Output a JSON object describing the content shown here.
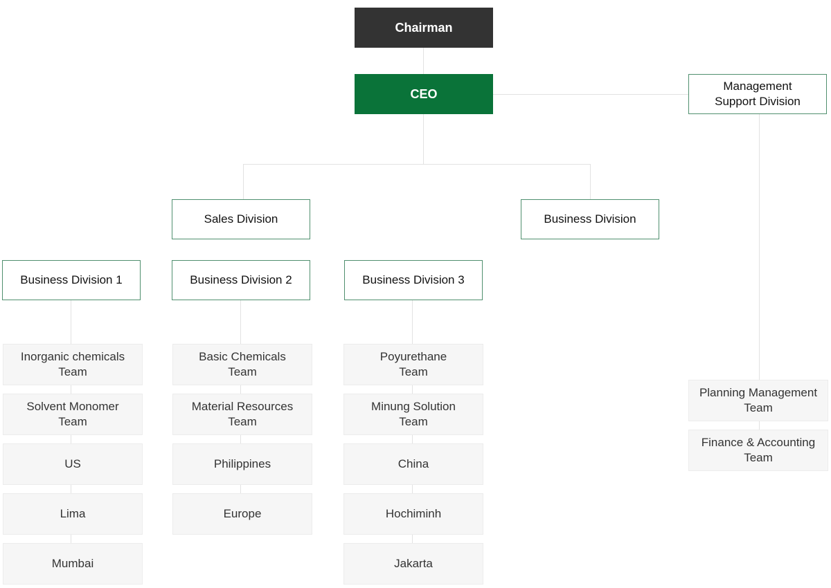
{
  "chairman": "Chairman",
  "ceo": "CEO",
  "management_support": "Management\nSupport Division",
  "sales_division": "Sales Division",
  "business_division": "Business Division",
  "divisions": [
    {
      "name": "Business Division 1",
      "teams": [
        "Inorganic chemicals\nTeam",
        "Solvent Monomer\nTeam",
        "US",
        "Lima",
        "Mumbai"
      ]
    },
    {
      "name": "Business Division 2",
      "teams": [
        "Basic Chemicals\nTeam",
        "Material Resources\nTeam",
        "Philippines",
        "Europe"
      ]
    },
    {
      "name": "Business Division 3",
      "teams": [
        "Poyurethane\nTeam",
        "Minung Solution\nTeam",
        "China",
        "Hochiminh",
        "Jakarta"
      ]
    }
  ],
  "support_teams": [
    "Planning Management\nTeam",
    "Finance & Accounting\nTeam"
  ],
  "colors": {
    "chairman_bg": "#333333",
    "ceo_bg": "#0a7339",
    "box_border": "#4f8f6e",
    "team_bg": "#f6f6f6",
    "connector": "#e2e2e2"
  }
}
